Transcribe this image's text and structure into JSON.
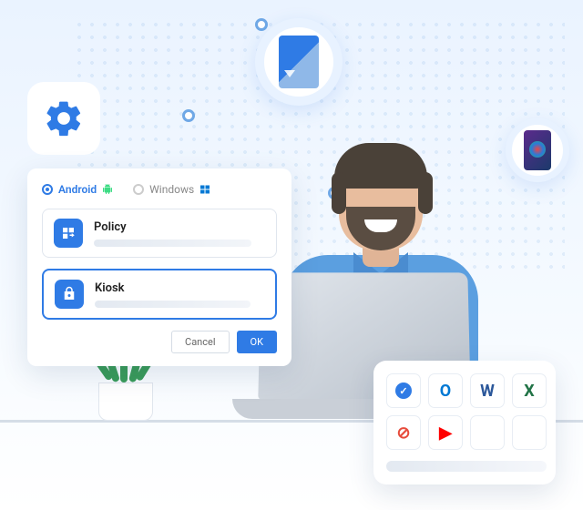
{
  "tabs": {
    "android": "Android",
    "windows": "Windows"
  },
  "rows": {
    "policy": "Policy",
    "kiosk": "Kiosk"
  },
  "buttons": {
    "cancel": "Cancel",
    "ok": "OK"
  },
  "apps": {
    "check": "✓",
    "outlook": "O",
    "word": "W",
    "excel": "X",
    "blocked": "⊘",
    "youtube": "▶"
  }
}
